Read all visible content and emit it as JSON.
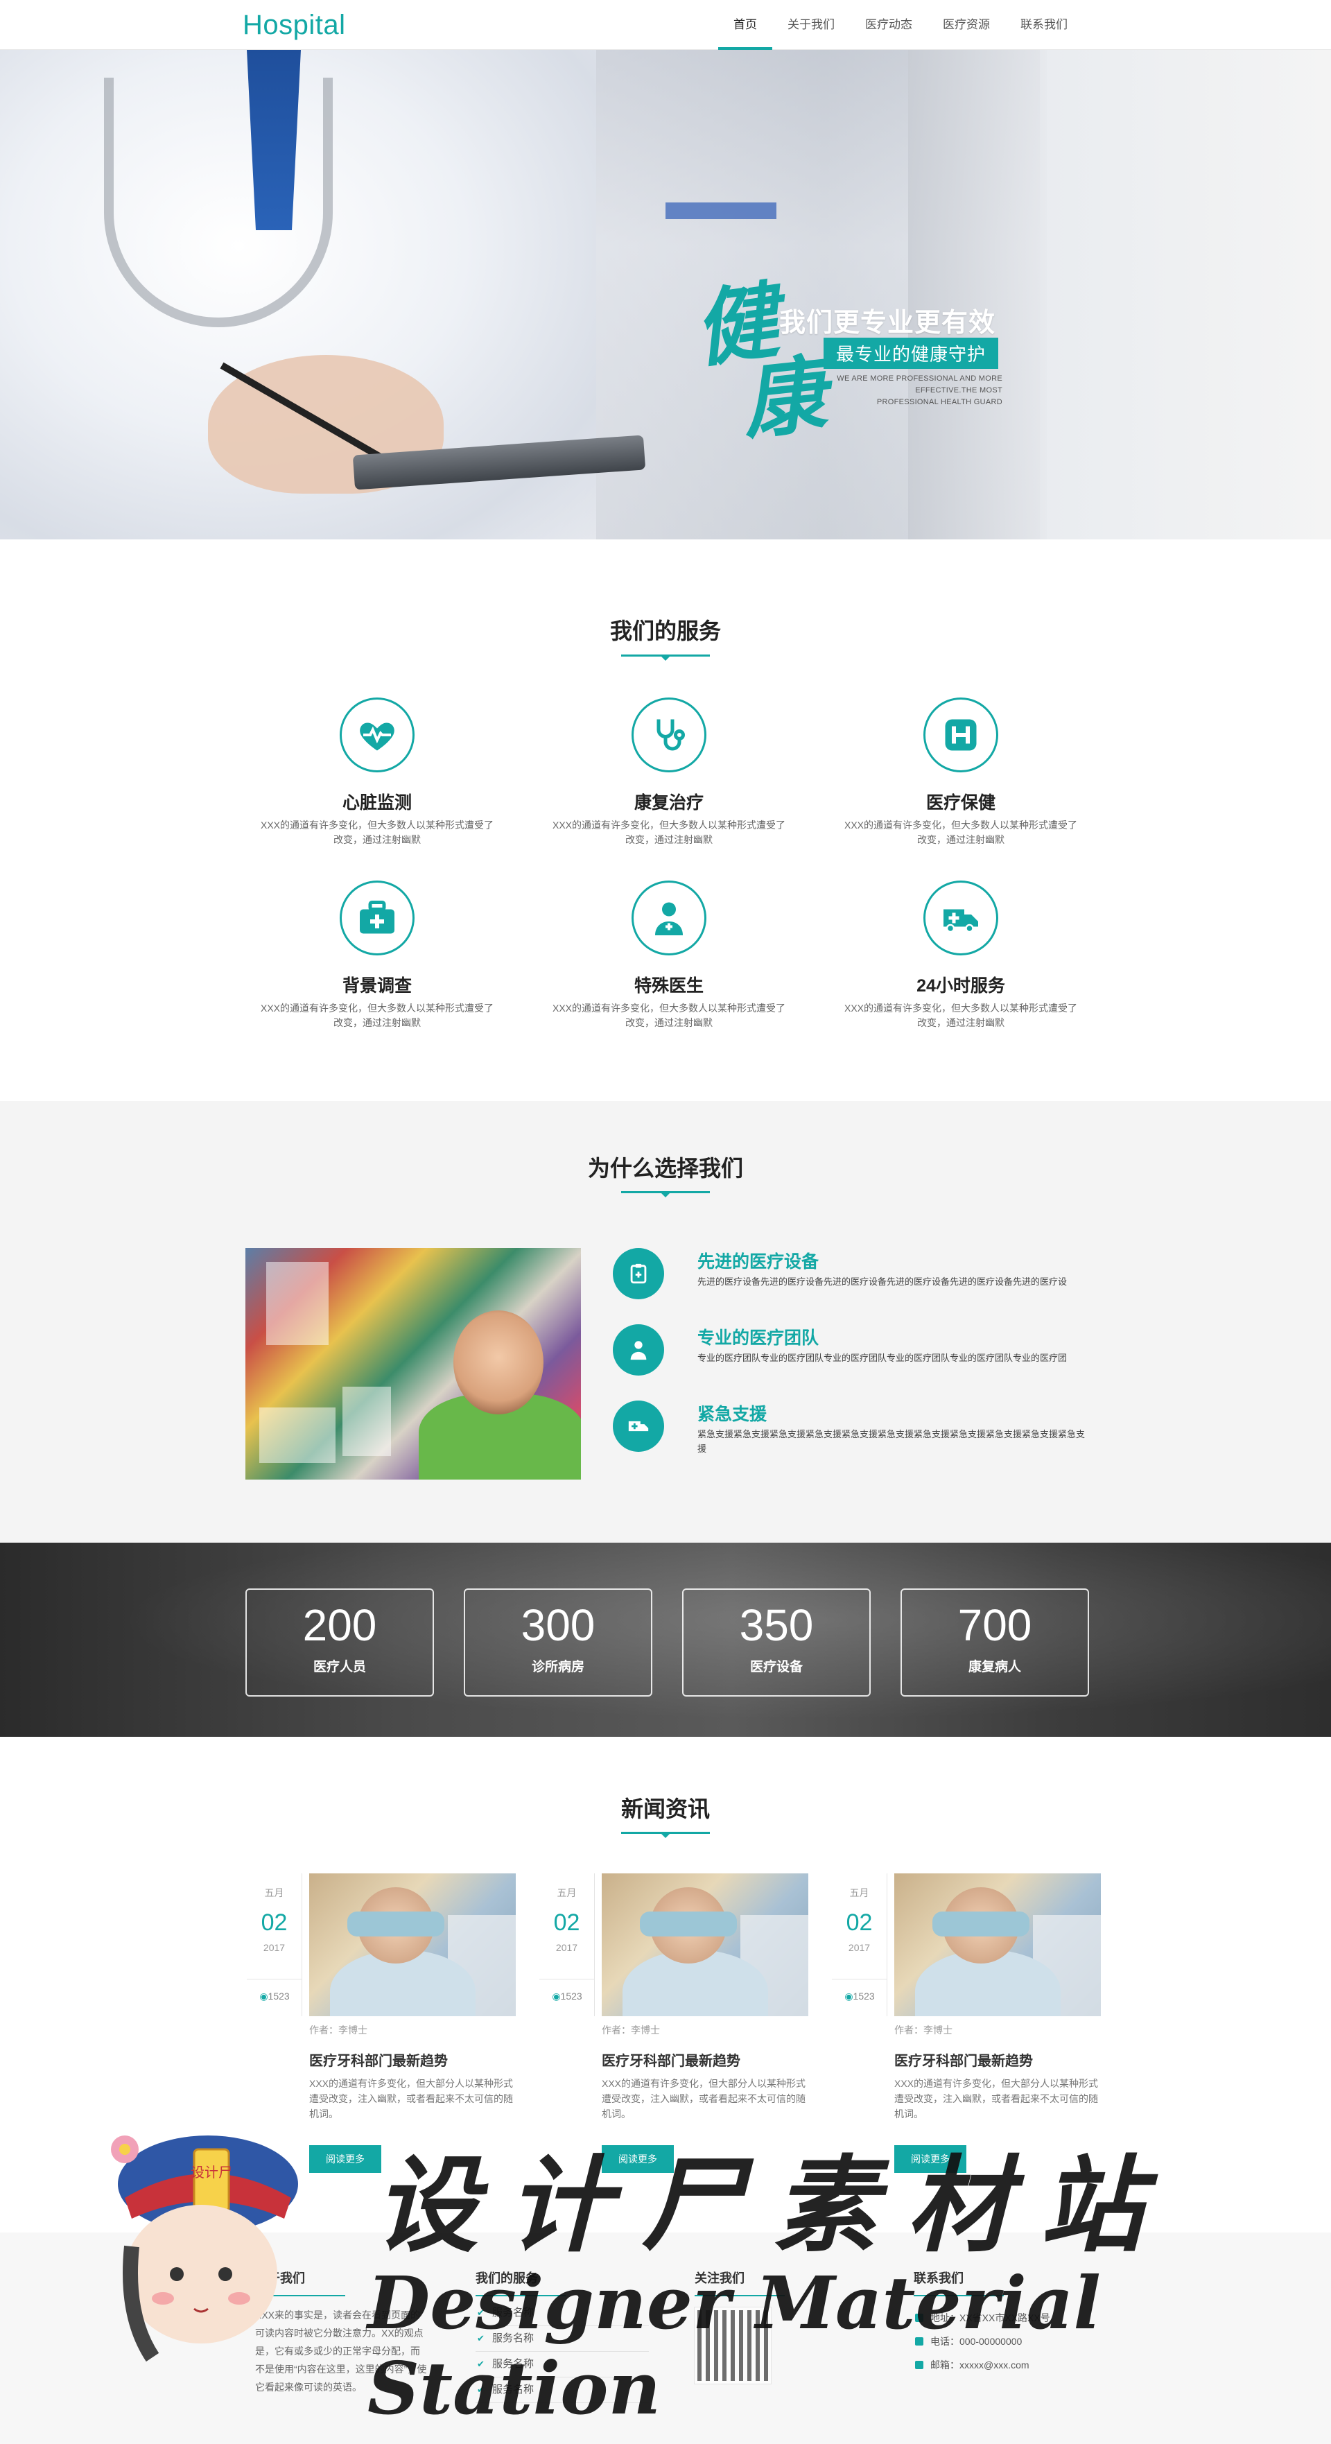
{
  "nav": {
    "logo": "Hospital",
    "items": [
      "首页",
      "关于我们",
      "医疗动态",
      "医疗资源",
      "联系我们"
    ]
  },
  "hero": {
    "char1": "健",
    "char2": "康",
    "title": "我们更专业更有效",
    "tag": "最专业的健康守护",
    "en_line1": "WE ARE MORE PROFESSIONAL AND MORE",
    "en_line2": "EFFECTIVE.THE MOST",
    "en_line3": "PROFESSIONAL HEALTH GUARD"
  },
  "services": {
    "title": "我们的服务",
    "items": [
      {
        "name": "心脏监测",
        "desc": "XXX的通道有许多变化，但大多数人以某种形式遭受了改变，通过注射幽默",
        "icon": "heart-monitor-icon"
      },
      {
        "name": "康复治疗",
        "desc": "XXX的通道有许多变化，但大多数人以某种形式遭受了改变，通过注射幽默",
        "icon": "stethoscope-icon"
      },
      {
        "name": "医疗保健",
        "desc": "XXX的通道有许多变化，但大多数人以某种形式遭受了改变，通过注射幽默",
        "icon": "hospital-h-icon"
      },
      {
        "name": "背景调查",
        "desc": "XXX的通道有许多变化，但大多数人以某种形式遭受了改变，通过注射幽默",
        "icon": "medical-kit-icon"
      },
      {
        "name": "特殊医生",
        "desc": "XXX的通道有许多变化，但大多数人以某种形式遭受了改变，通过注射幽默",
        "icon": "doctor-icon"
      },
      {
        "name": "24小时服务",
        "desc": "XXX的通道有许多变化，但大多数人以某种形式遭受了改变，通过注射幽默",
        "icon": "ambulance-icon"
      }
    ]
  },
  "why": {
    "title": "为什么选择我们",
    "items": [
      {
        "title": "先进的医疗设备",
        "desc": "先进的医疗设备先进的医疗设备先进的医疗设备先进的医疗设备先进的医疗设备先进的医疗设"
      },
      {
        "title": "专业的医疗团队",
        "desc": "专业的医疗团队专业的医疗团队专业的医疗团队专业的医疗团队专业的医疗团队专业的医疗团"
      },
      {
        "title": "紧急支援",
        "desc": "紧急支援紧急支援紧急支援紧急支援紧急支援紧急支援紧急支援紧急支援紧急支援紧急支援紧急支援"
      }
    ]
  },
  "stats": [
    {
      "num": "200",
      "label": "医疗人员"
    },
    {
      "num": "300",
      "label": "诊所病房"
    },
    {
      "num": "350",
      "label": "医疗设备"
    },
    {
      "num": "700",
      "label": "康复病人"
    }
  ],
  "news": {
    "title": "新闻资讯",
    "items": [
      {
        "month": "五月",
        "day": "02",
        "year": "2017",
        "views": "1523",
        "author": "作者：李博士",
        "headline": "医疗牙科部门最新趋势",
        "desc": "XXX的通道有许多变化，但大部分人以某种形式遭受改变，注入幽默，或者看起来不太可信的随机词。",
        "more": "阅读更多"
      },
      {
        "month": "五月",
        "day": "02",
        "year": "2017",
        "views": "1523",
        "author": "作者：李博士",
        "headline": "医疗牙科部门最新趋势",
        "desc": "XXX的通道有许多变化，但大部分人以某种形式遭受改变，注入幽默，或者看起来不太可信的随机词。",
        "more": "阅读更多"
      },
      {
        "month": "五月",
        "day": "02",
        "year": "2017",
        "views": "1523",
        "author": "作者：李博士",
        "headline": "医疗牙科部门最新趋势",
        "desc": "XXX的通道有许多变化，但大部分人以某种形式遭受改变，注入幽默，或者看起来不太可信的随机词。",
        "more": "阅读更多"
      }
    ]
  },
  "footer": {
    "about": {
      "title": "关于我们",
      "text": "XXX来的事实是，读者会在看到页面的可读内容时被它分散注意力。XX的观点是，它有或多或少的正常字母分配，而不是使用“内容在这里，这里的内容”，使它看起来像可读的英语。"
    },
    "services": {
      "title": "我们的服务",
      "items": [
        "服务名称",
        "服务名称",
        "服务名称",
        "服务名称"
      ]
    },
    "follow": {
      "title": "关注我们"
    },
    "contact": {
      "title": "联系我们",
      "address": "地址：XX省XX市XX路XX号",
      "phone": "电话：000-00000000",
      "email": "邮箱：xxxxx@xxx.com"
    }
  },
  "watermark": {
    "cn": "设计尸素材站",
    "en": "Designer Material Station",
    "badge": "设计尸"
  },
  "colors": {
    "accent": "#13a8a5",
    "dot_active": "#e65a2b"
  }
}
